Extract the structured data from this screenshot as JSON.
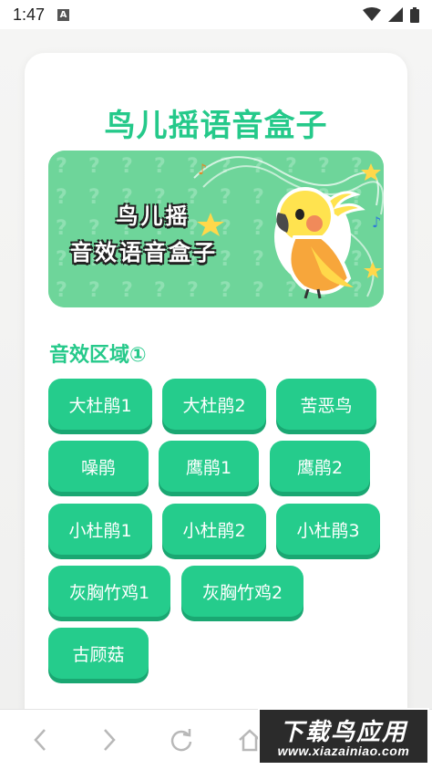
{
  "status_bar": {
    "time": "1:47",
    "notification_icon": "a-icon",
    "icons": [
      "wifi-icon",
      "signal-icon",
      "battery-icon"
    ]
  },
  "page": {
    "title": "鸟儿摇语音盒子",
    "banner": {
      "line1": "鸟儿摇",
      "line2": "音效语音盒子",
      "image": "cockatiel-parrot-illustration"
    },
    "section_title": "音效区域①",
    "buttons": [
      "大杜鹃1",
      "大杜鹃2",
      "苦恶鸟",
      "噪鹃",
      "鹰鹃1",
      "鹰鹃2",
      "小杜鹃1",
      "小杜鹃2",
      "小杜鹃3",
      "灰胸竹鸡1",
      "灰胸竹鸡2",
      "古顾菇"
    ]
  },
  "browser_nav": {
    "icons": [
      "back-arrow-icon",
      "forward-arrow-icon",
      "reload-icon",
      "home-icon"
    ]
  },
  "watermark": {
    "main": "下载鸟应用",
    "url": "www.xiazainiao.com"
  },
  "colors": {
    "accent": "#25cc8c",
    "accent_shadow": "#1aa772",
    "banner_bg": "#6ed59a"
  }
}
